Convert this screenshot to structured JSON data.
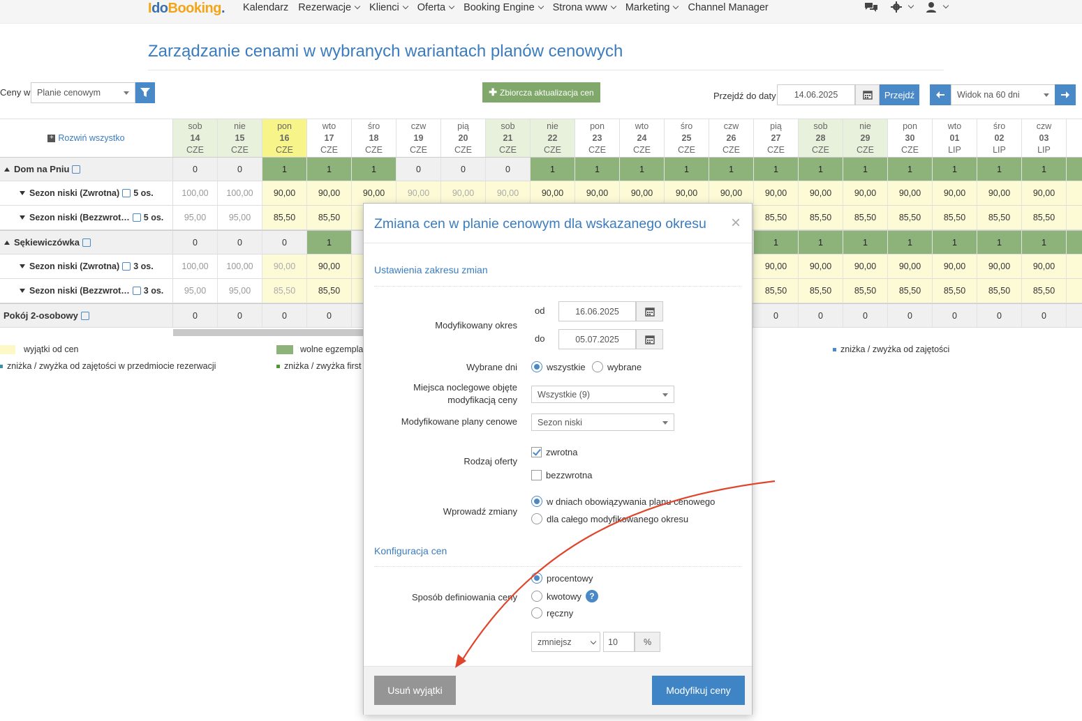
{
  "nav": {
    "logo_a": "I",
    "logo_b": "do",
    "logo_c": "Booking",
    "logo_dot": ".",
    "items": [
      "Kalendarz",
      "Rezerwacje",
      "Klienci",
      "Oferta",
      "Booking Engine",
      "Strona www",
      "Marketing",
      "Channel Manager"
    ],
    "has_dropdown": [
      false,
      true,
      true,
      true,
      true,
      true,
      true,
      false
    ]
  },
  "page": {
    "title": "Zarządzanie cenami w wybranych wariantach planów cenowych",
    "ceny_label": "Ceny w",
    "ceny_select": "Planie cenowym",
    "bulk_update_label": "Zbiorcza aktualizacja cen",
    "goto_label": "Przejdź do daty",
    "goto_date": "14.06.2025",
    "goto_button": "Przejdź",
    "view_select": "Widok na 60 dni",
    "expand_all": "Rozwiń wszystko"
  },
  "days": [
    {
      "dow": "sob",
      "d": "14",
      "m": "CZE"
    },
    {
      "dow": "nie",
      "d": "15",
      "m": "CZE"
    },
    {
      "dow": "pon",
      "d": "16",
      "m": "CZE"
    },
    {
      "dow": "wto",
      "d": "17",
      "m": "CZE"
    },
    {
      "dow": "śro",
      "d": "18",
      "m": "CZE"
    },
    {
      "dow": "czw",
      "d": "19",
      "m": "CZE"
    },
    {
      "dow": "pią",
      "d": "20",
      "m": "CZE"
    },
    {
      "dow": "sob",
      "d": "21",
      "m": "CZE"
    },
    {
      "dow": "nie",
      "d": "22",
      "m": "CZE"
    },
    {
      "dow": "pon",
      "d": "23",
      "m": "CZE"
    },
    {
      "dow": "wto",
      "d": "24",
      "m": "CZE"
    },
    {
      "dow": "śro",
      "d": "25",
      "m": "CZE"
    },
    {
      "dow": "czw",
      "d": "26",
      "m": "CZE"
    },
    {
      "dow": "pią",
      "d": "27",
      "m": "CZE"
    },
    {
      "dow": "sob",
      "d": "28",
      "m": "CZE"
    },
    {
      "dow": "nie",
      "d": "29",
      "m": "CZE"
    },
    {
      "dow": "pon",
      "d": "30",
      "m": "CZE"
    },
    {
      "dow": "wto",
      "d": "01",
      "m": "LIP"
    },
    {
      "dow": "śro",
      "d": "02",
      "m": "LIP"
    },
    {
      "dow": "czw",
      "d": "03",
      "m": "LIP"
    }
  ],
  "rows": [
    {
      "label": "Dom na Pniu",
      "type": "object",
      "values": [
        "0",
        "0",
        "1",
        "1",
        "1",
        "0",
        "0",
        "0",
        "1",
        "1",
        "1",
        "1",
        "1",
        "1",
        "1",
        "1",
        "1",
        "1",
        "1",
        "1"
      ]
    },
    {
      "label": "Sezon niski (Zwrotna)",
      "persons": "5 os.",
      "type": "plan",
      "values": [
        "100,00",
        "100,00",
        "90,00",
        "90,00",
        "90,00",
        "90,00",
        "90,00",
        "90,00",
        "90,00",
        "90,00",
        "90,00",
        "90,00",
        "90,00",
        "90,00",
        "90,00",
        "90,00",
        "90,00",
        "90,00",
        "90,00",
        "90,00"
      ]
    },
    {
      "label": "Sezon niski (Bezzwrot…",
      "persons": "5 os.",
      "type": "plan",
      "values": [
        "95,00",
        "95,00",
        "85,50",
        "85,50",
        "",
        "",
        "",
        "",
        "",
        "",
        "",
        "",
        "",
        "85,50",
        "85,50",
        "85,50",
        "85,50",
        "85,50",
        "85,50",
        "85,50"
      ]
    },
    {
      "label": "Sękiewiczówka",
      "type": "object",
      "values": [
        "0",
        "0",
        "0",
        "1",
        "",
        "",
        "",
        "",
        "",
        "",
        "",
        "",
        "",
        "1",
        "1",
        "1",
        "1",
        "1",
        "1",
        "1"
      ]
    },
    {
      "label": "Sezon niski (Zwrotna)",
      "persons": "3 os.",
      "type": "plan",
      "values": [
        "100,00",
        "100,00",
        "90,00",
        "90,00",
        "",
        "",
        "",
        "",
        "",
        "",
        "",
        "",
        "",
        "90,00",
        "90,00",
        "90,00",
        "90,00",
        "90,00",
        "90,00",
        "90,00"
      ]
    },
    {
      "label": "Sezon niski (Bezzwrot…",
      "persons": "3 os.",
      "type": "plan",
      "values": [
        "95,00",
        "95,00",
        "85,50",
        "85,50",
        "",
        "",
        "",
        "",
        "",
        "",
        "",
        "",
        "",
        "85,50",
        "85,50",
        "85,50",
        "85,50",
        "85,50",
        "85,50",
        "85,50"
      ]
    },
    {
      "label": "Pokój 2-osobowy",
      "type": "object",
      "values": [
        "0",
        "0",
        "0",
        "0",
        "",
        "",
        "",
        "",
        "",
        "",
        "",
        "",
        "",
        "0",
        "0",
        "0",
        "0",
        "0",
        "0",
        "0"
      ]
    }
  ],
  "legend": {
    "exceptions": "wyjątki od cen",
    "free_units": "wolne egzemplar",
    "occupancy_discount": "zniżka / zwyżka od zajętości",
    "occupancy_discount_item": "zniżka / zwyżka od zajętości w przedmiocie rezerwacji",
    "first_discount": "zniżka / zwyżka first"
  },
  "modal": {
    "title": "Zmiana cen w planie cenowym dla wskazanego okresu",
    "section_range": "Ustawienia zakresu zmian",
    "period_label": "Modyfikowany okres",
    "from_label": "od",
    "from_value": "16.06.2025",
    "to_label": "do",
    "to_value": "05.07.2025",
    "days_label": "Wybrane dni",
    "days_all": "wszystkie",
    "days_selected": "wybrane",
    "places_label_1": "Miejsca noclegowe objęte",
    "places_label_2": "modyfikacją ceny",
    "places_value": "Wszystkie (9)",
    "plans_label": "Modyfikowane plany cenowe",
    "plans_value": "Sezon niski",
    "offer_label": "Rodzaj oferty",
    "offer_refundable": "zwrotna",
    "offer_nonrefundable": "bezzwrotna",
    "apply_label": "Wprowadź zmiany",
    "apply_in_days": "w dniach obowiązywania planu cenowego",
    "apply_whole": "dla całego modyfikowanego okresu",
    "section_config": "Konfiguracja cen",
    "method_label": "Sposób definiowania ceny",
    "method_percent": "procentowy",
    "method_amount": "kwotowy",
    "method_manual": "ręczny",
    "help": "?",
    "direction_value": "zmniejsz",
    "amount_value": "10",
    "unit": "%",
    "remove_exceptions": "Usuń wyjątki",
    "modify_prices": "Modyfikuj ceny",
    "close": "×"
  },
  "colors": {
    "accent": "#3a7cbf",
    "green_cell": "#8db27a",
    "weekend_header": "#e8f1dc",
    "today_header": "#f7f58a",
    "exception": "#fdfbd6",
    "annotation_arrow": "#e0452b"
  }
}
